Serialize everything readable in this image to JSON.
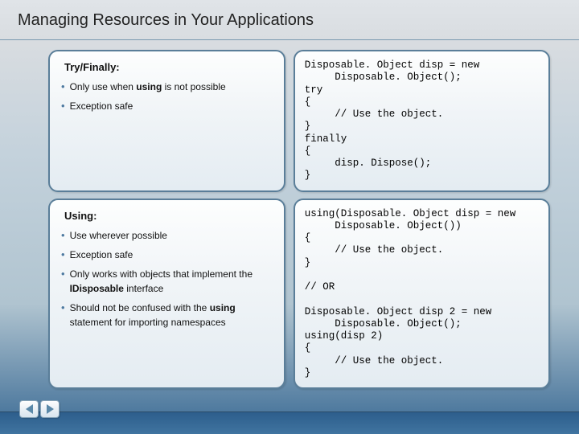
{
  "title": "Managing Resources in Your Applications",
  "section1": {
    "heading": "Try/Finally:",
    "bullets": [
      "Only use when <b>using</b> is not possible",
      "Exception safe"
    ],
    "code": "Disposable. Object disp = new\n     Disposable. Object();\ntry\n{\n     // Use the object.\n}\nfinally\n{\n     disp. Dispose();\n}"
  },
  "section2": {
    "heading": "Using:",
    "bullets": [
      "Use wherever possible",
      "Exception safe",
      "Only works with objects that implement the <b>IDisposable</b> interface",
      "Should not be confused with the <b>using</b> statement for importing namespaces"
    ],
    "code": "using(Disposable. Object disp = new\n     Disposable. Object())\n{\n     // Use the object.\n}\n\n// OR\n\nDisposable. Object disp 2 = new\n     Disposable. Object();\nusing(disp 2)\n{\n     // Use the object.\n}"
  },
  "nav": {
    "prev": "prev",
    "next": "next"
  }
}
